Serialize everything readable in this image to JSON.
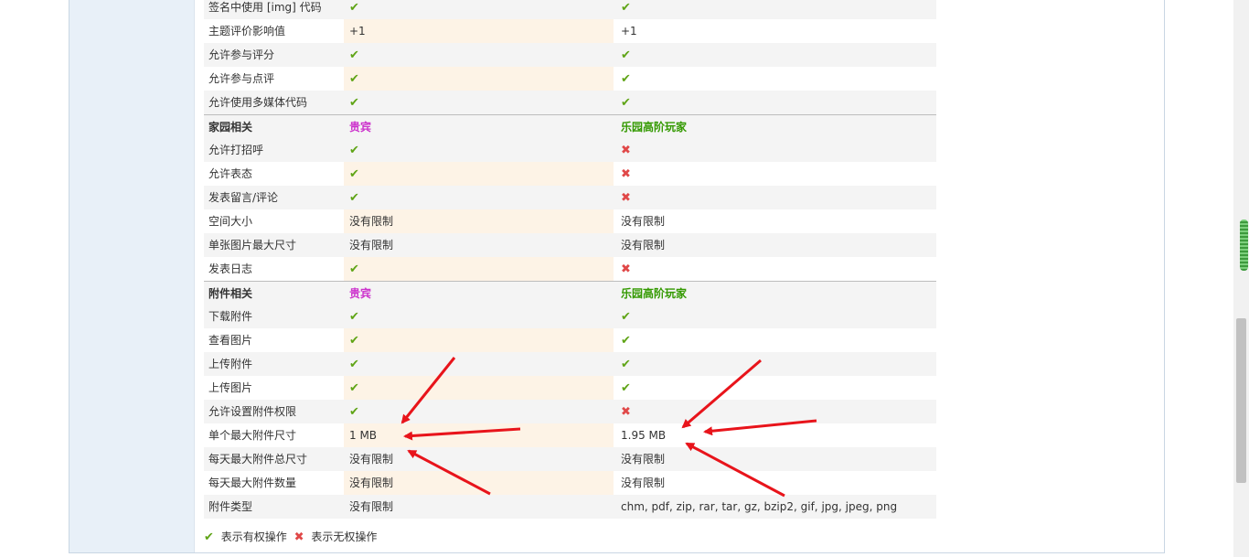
{
  "rows": [
    {
      "label": "签名中使用 [img] 代码",
      "a": "check",
      "b": "check",
      "alt": true
    },
    {
      "label": "主题评价影响值",
      "a": "+1",
      "b": "+1",
      "alt": false
    },
    {
      "label": "允许参与评分",
      "a": "check",
      "b": "check",
      "alt": true
    },
    {
      "label": "允许参与点评",
      "a": "check",
      "b": "check",
      "alt": false
    },
    {
      "label": "允许使用多媒体代码",
      "a": "check",
      "b": "check",
      "alt": true
    },
    {
      "label": "家园相关",
      "a": "贵宾",
      "b": "乐园高阶玩家",
      "hdr": true
    },
    {
      "label": "允许打招呼",
      "a": "check",
      "b": "cross",
      "alt": true
    },
    {
      "label": "允许表态",
      "a": "check",
      "b": "cross",
      "alt": false
    },
    {
      "label": "发表留言/评论",
      "a": "check",
      "b": "cross",
      "alt": true
    },
    {
      "label": "空间大小",
      "a": "没有限制",
      "b": "没有限制",
      "alt": false
    },
    {
      "label": "单张图片最大尺寸",
      "a": "没有限制",
      "b": "没有限制",
      "alt": true
    },
    {
      "label": "发表日志",
      "a": "check",
      "b": "cross",
      "alt": false
    },
    {
      "label": "附件相关",
      "a": "贵宾",
      "b": "乐园高阶玩家",
      "hdr": true
    },
    {
      "label": "下载附件",
      "a": "check",
      "b": "check",
      "alt": true
    },
    {
      "label": "查看图片",
      "a": "check",
      "b": "check",
      "alt": false
    },
    {
      "label": "上传附件",
      "a": "check",
      "b": "check",
      "alt": true
    },
    {
      "label": "上传图片",
      "a": "check",
      "b": "check",
      "alt": false
    },
    {
      "label": "允许设置附件权限",
      "a": "check",
      "b": "cross",
      "alt": true
    },
    {
      "label": "单个最大附件尺寸",
      "a": "1 MB",
      "b": "1.95 MB",
      "alt": false
    },
    {
      "label": "每天最大附件总尺寸",
      "a": "没有限制",
      "b": "没有限制",
      "alt": true
    },
    {
      "label": "每天最大附件数量",
      "a": "没有限制",
      "b": "没有限制",
      "alt": false
    },
    {
      "label": "附件类型",
      "a": "没有限制",
      "b": "chm, pdf, zip, rar, tar, gz, bzip2, gif, jpg, jpeg, png",
      "alt": true
    }
  ],
  "legend": {
    "allowed": "表示有权操作",
    "denied": "表示无权操作"
  },
  "icons": {
    "check": "✔",
    "cross": "✖"
  },
  "colors": {
    "group1": "#cc33cc",
    "group2": "#339900",
    "check": "#5fa416",
    "cross": "#e04848",
    "annotation": "#e8141b"
  }
}
